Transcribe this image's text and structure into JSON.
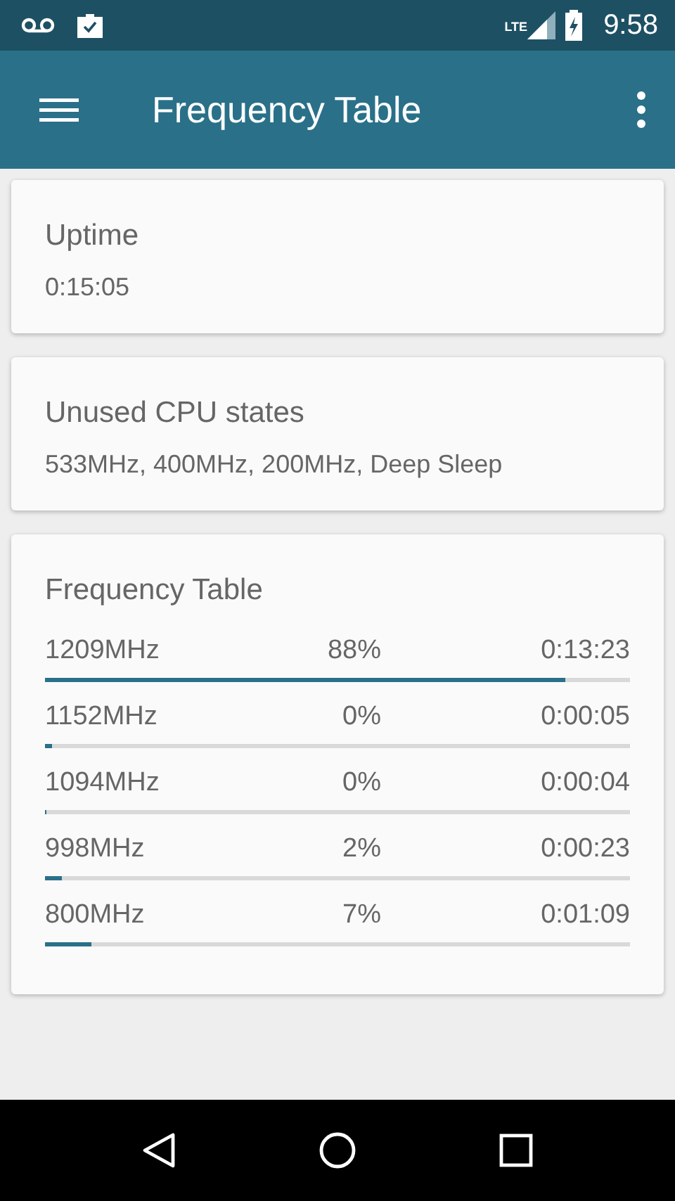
{
  "status_bar": {
    "time": "9:58",
    "network": "LTE"
  },
  "toolbar": {
    "title": "Frequency Table"
  },
  "cards": [
    {
      "title": "Uptime",
      "value": "0:15:05"
    },
    {
      "title": "Unused CPU states",
      "value": "533MHz, 400MHz, 200MHz, Deep Sleep"
    }
  ],
  "frequency_table": {
    "title": "Frequency Table",
    "rows": [
      {
        "frequency": "1209MHz",
        "percent": "88%",
        "time": "0:13:23",
        "level": 0.89
      },
      {
        "frequency": "1152MHz",
        "percent": "0%",
        "time": "0:00:05",
        "level": 0.012
      },
      {
        "frequency": "1094MHz",
        "percent": "0%",
        "time": "0:00:04",
        "level": 0
      },
      {
        "frequency": "998MHz",
        "percent": "2%",
        "time": "0:00:23",
        "level": 0.03
      },
      {
        "frequency": "800MHz",
        "percent": "7%",
        "time": "0:01:09",
        "level": 0.08
      }
    ]
  }
}
